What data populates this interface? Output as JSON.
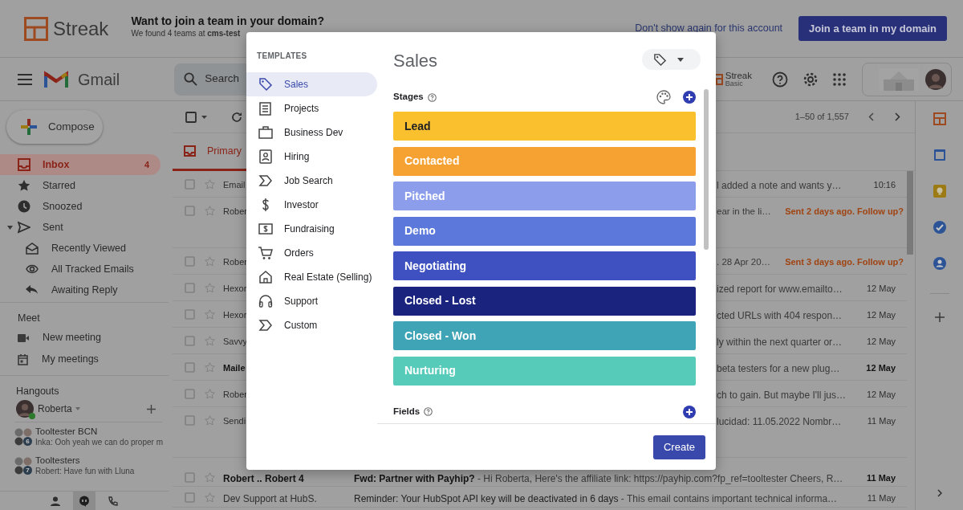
{
  "banner": {
    "title": "Want to join a team in your domain?",
    "subtitle": "We found 4 teams at **cms-test**",
    "dismiss_link": "Don't show again for this account",
    "join_button": "Join a team in my domain",
    "logo_text": "Streak"
  },
  "header": {
    "app_name": "Gmail",
    "search_placeholder": "Search",
    "streak_name": "Streak",
    "streak_plan": "Basic"
  },
  "sidebar": {
    "compose": "Compose",
    "items": [
      {
        "label": "Inbox",
        "count": "4",
        "selected": true
      },
      {
        "label": "Starred",
        "selected": false
      },
      {
        "label": "Snoozed",
        "selected": false
      },
      {
        "label": "Sent",
        "selected": false,
        "expanded": true,
        "children": [
          {
            "label": "Recently Viewed",
            "selected": false
          },
          {
            "label": "All Tracked Emails",
            "selected": false
          },
          {
            "label": "Awaiting Reply",
            "selected": false
          }
        ]
      }
    ]
  },
  "meet": {
    "title": "Meet",
    "items": [
      "New meeting",
      "My meetings"
    ]
  },
  "hangouts": {
    "title": "Hangouts",
    "user": "Roberta",
    "conversations": [
      {
        "name": "Tooltester BCN",
        "preview": "Inka: Ooh yeah we can do proper m",
        "count": "6"
      },
      {
        "name": "Tooltesters",
        "preview": "Robert: Have fun with Lluna",
        "count": "7"
      }
    ]
  },
  "toolbar": {
    "range": "1–50 of 1,557",
    "select_all_checked": false
  },
  "tabs": [
    {
      "label": "Primary",
      "selected": true
    }
  ],
  "emails": [
    {
      "sender": "Email",
      "snippet": "l added a note and wants y…",
      "date": "10:16",
      "unread": false,
      "checked": false,
      "tall": false
    },
    {
      "sender": "Rober",
      "snippet": "ear in the li…",
      "follow_up": "Sent 2 days ago. Follow up?",
      "unread": false,
      "checked": false,
      "tall": true
    },
    {
      "sender": "Rober",
      "snippet": ". 28 Apr 20…",
      "follow_up": "Sent 3 days ago. Follow up?",
      "unread": false,
      "checked": false,
      "tall": false
    },
    {
      "sender": "Hexor",
      "snippet": "ized report for www.emailto…",
      "date": "12 May",
      "unread": false,
      "checked": false,
      "tall": false
    },
    {
      "sender": "Hexor",
      "snippet": "cted URLs with 404 respon…",
      "date": "12 May",
      "unread": false,
      "checked": false,
      "tall": false
    },
    {
      "sender": "Savvy",
      "snippet": "ly within the next quarter or…",
      "date": "12 May",
      "unread": false,
      "checked": false,
      "tall": false
    },
    {
      "sender": "Maile",
      "snippet": "beta testers for a new plug…",
      "date": "12 May",
      "unread": true,
      "checked": false,
      "tall": false
    },
    {
      "sender": "Rober",
      "snippet": "ch to gain. But maybe I'll jus…",
      "date": "12 May",
      "unread": false,
      "checked": false,
      "tall": false
    },
    {
      "sender": "Sendi",
      "snippet": "lucidad: 11.05.2022 Nombr…",
      "date": "11 May",
      "unread": false,
      "checked": false,
      "tall": true
    },
    {
      "sender": "Robert .. **Robert** 4",
      "subject": "Fwd: Partner with Payhip?",
      "snippet": "- Hi Roberta, Here's the affiliate link: https://payhip.com?fp_ref=tooltester Cheers, R…",
      "date": "11 May",
      "unread": true,
      "checked": false,
      "tall": false
    },
    {
      "sender": "Dev Support at HubS.",
      "subject": "Reminder: Your HubSpot API key will be deactivated in 6 days",
      "snippet": "- This email contains important technical informa…",
      "date": "11 May",
      "unread": false,
      "checked": false,
      "tall": false
    }
  ],
  "modal": {
    "section_title": "TEMPLATES",
    "templates": [
      {
        "label": "Sales",
        "selected": true
      },
      {
        "label": "Projects",
        "selected": false
      },
      {
        "label": "Business Dev",
        "selected": false
      },
      {
        "label": "Hiring",
        "selected": false
      },
      {
        "label": "Job Search",
        "selected": false
      },
      {
        "label": "Investor",
        "selected": false
      },
      {
        "label": "Fundraising",
        "selected": false
      },
      {
        "label": "Orders",
        "selected": false
      },
      {
        "label": "Real Estate (Selling)",
        "selected": false
      },
      {
        "label": "Support",
        "selected": false
      },
      {
        "label": "Custom",
        "selected": false
      }
    ],
    "title": "Sales",
    "stages_label": "Stages",
    "stages": [
      {
        "name": "Lead",
        "color": "#fbc02d"
      },
      {
        "name": "Contacted",
        "color": "#f5a233"
      },
      {
        "name": "Pitched",
        "color": "#8c9eeb"
      },
      {
        "name": "Demo",
        "color": "#5c78da"
      },
      {
        "name": "Negotiating",
        "color": "#3f51c0"
      },
      {
        "name": "Closed - Lost",
        "color": "#1a237e"
      },
      {
        "name": "Closed - Won",
        "color": "#3fa5b6"
      },
      {
        "name": "Nurturing",
        "color": "#56cbb9"
      }
    ],
    "fields_label": "Fields",
    "create_button": "Create"
  }
}
